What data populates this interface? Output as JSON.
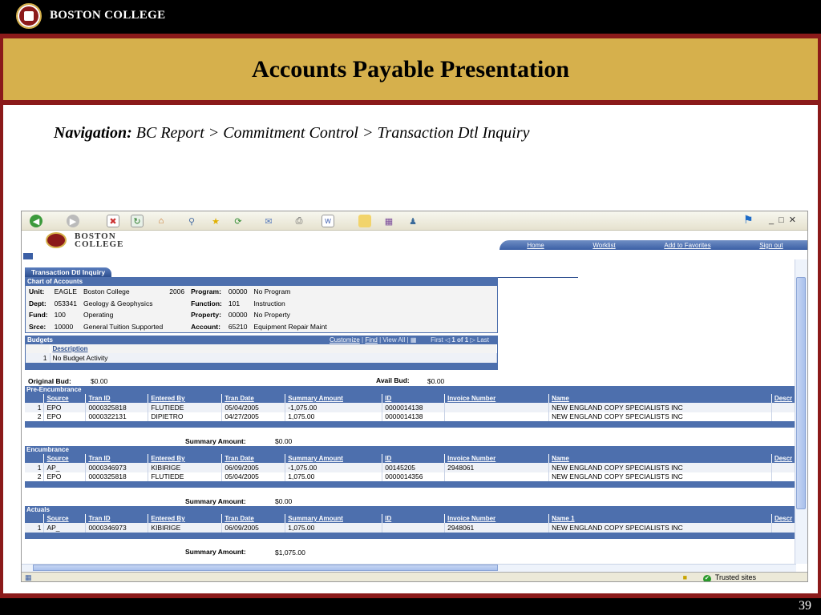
{
  "slide": {
    "brand": "BOSTON COLLEGE",
    "title": "Accounts Payable Presentation",
    "nav_label": "Navigation:",
    "nav_path": "BC Report > Commitment Control > Transaction Dtl  Inquiry",
    "page_number": "39"
  },
  "browser": {
    "logo_text_1": "BOSTON",
    "logo_text_2": "COLLEGE",
    "header_links": [
      "Home",
      "Worklist",
      "Add to Favorites",
      "Sign out"
    ],
    "status": "Trusted sites"
  },
  "page": {
    "tab": "Transaction Dtl Inquiry",
    "coa": {
      "header": "Chart of Accounts",
      "rows": [
        {
          "l1": "Unit:",
          "v1": "EAGLE",
          "d1": "Boston College",
          "y": "2006",
          "l2": "Program:",
          "v2": "00000",
          "d2": "No Program"
        },
        {
          "l1": "Dept:",
          "v1": "053341",
          "d1": "Geology & Geophysics",
          "y": "",
          "l2": "Function:",
          "v2": "101",
          "d2": "Instruction"
        },
        {
          "l1": "Fund:",
          "v1": "100",
          "d1": "Operating",
          "y": "",
          "l2": "Property:",
          "v2": "00000",
          "d2": "No Property"
        },
        {
          "l1": "Srce:",
          "v1": "10000",
          "d1": "General Tuition Supported",
          "y": "",
          "l2": "Account:",
          "v2": "65210",
          "d2": "Equipment Repair  Maint"
        }
      ]
    },
    "budgets": {
      "header": "Budgets",
      "customize": "Customize",
      "find": "Find",
      "view_all": "View All",
      "first": "First",
      "range": "1 of 1",
      "last": "Last",
      "col": "Description",
      "row_num": "1",
      "row_val": "No Budget Activity"
    },
    "orig_bud_label": "Original Bud:",
    "orig_bud_val": "$0.00",
    "avail_bud_label": "Avail Bud:",
    "avail_bud_val": "$0.00",
    "columns": [
      "Source",
      "Tran ID",
      "Entered By",
      "Tran Date",
      "Summary Amount",
      "ID",
      "Invoice Number",
      "Name",
      "Descr"
    ],
    "actual_columns": [
      "Source",
      "Tran ID",
      "Entered By",
      "Tran Date",
      "Summary Amount",
      "ID",
      "Invoice Number",
      "Name 1",
      "Descr"
    ],
    "pre": {
      "header": "Pre-Encumbrance",
      "rows": [
        [
          "1",
          "EPO",
          "0000325818",
          "FLUTIEDE",
          "05/04/2005",
          "-1,075.00",
          "0000014138",
          "",
          "NEW ENGLAND COPY SPECIALISTS INC"
        ],
        [
          "2",
          "EPO",
          "0000322131",
          "DIPIETRO",
          "04/27/2005",
          "1,075.00",
          "0000014138",
          "",
          "NEW ENGLAND COPY SPECIALISTS INC"
        ]
      ],
      "summary_label": "Summary Amount:",
      "summary_val": "$0.00"
    },
    "enc": {
      "header": "Encumbrance",
      "rows": [
        [
          "1",
          "AP_",
          "0000346973",
          "KIBIRIGE",
          "06/09/2005",
          "-1,075.00",
          "00145205",
          "2948061",
          "NEW ENGLAND COPY SPECIALISTS INC"
        ],
        [
          "2",
          "EPO",
          "0000325818",
          "FLUTIEDE",
          "05/04/2005",
          "1,075.00",
          "0000014356",
          "",
          "NEW ENGLAND COPY SPECIALISTS INC"
        ]
      ],
      "summary_label": "Summary Amount:",
      "summary_val": "$0.00"
    },
    "act": {
      "header": "Actuals",
      "rows": [
        [
          "1",
          "AP_",
          "0000346973",
          "KIBIRIGE",
          "06/09/2005",
          "1,075.00",
          "",
          "2948061",
          "NEW ENGLAND COPY SPECIALISTS INC"
        ]
      ],
      "summary_label": "Summary Amount:",
      "summary_val": "$1,075.00"
    }
  }
}
